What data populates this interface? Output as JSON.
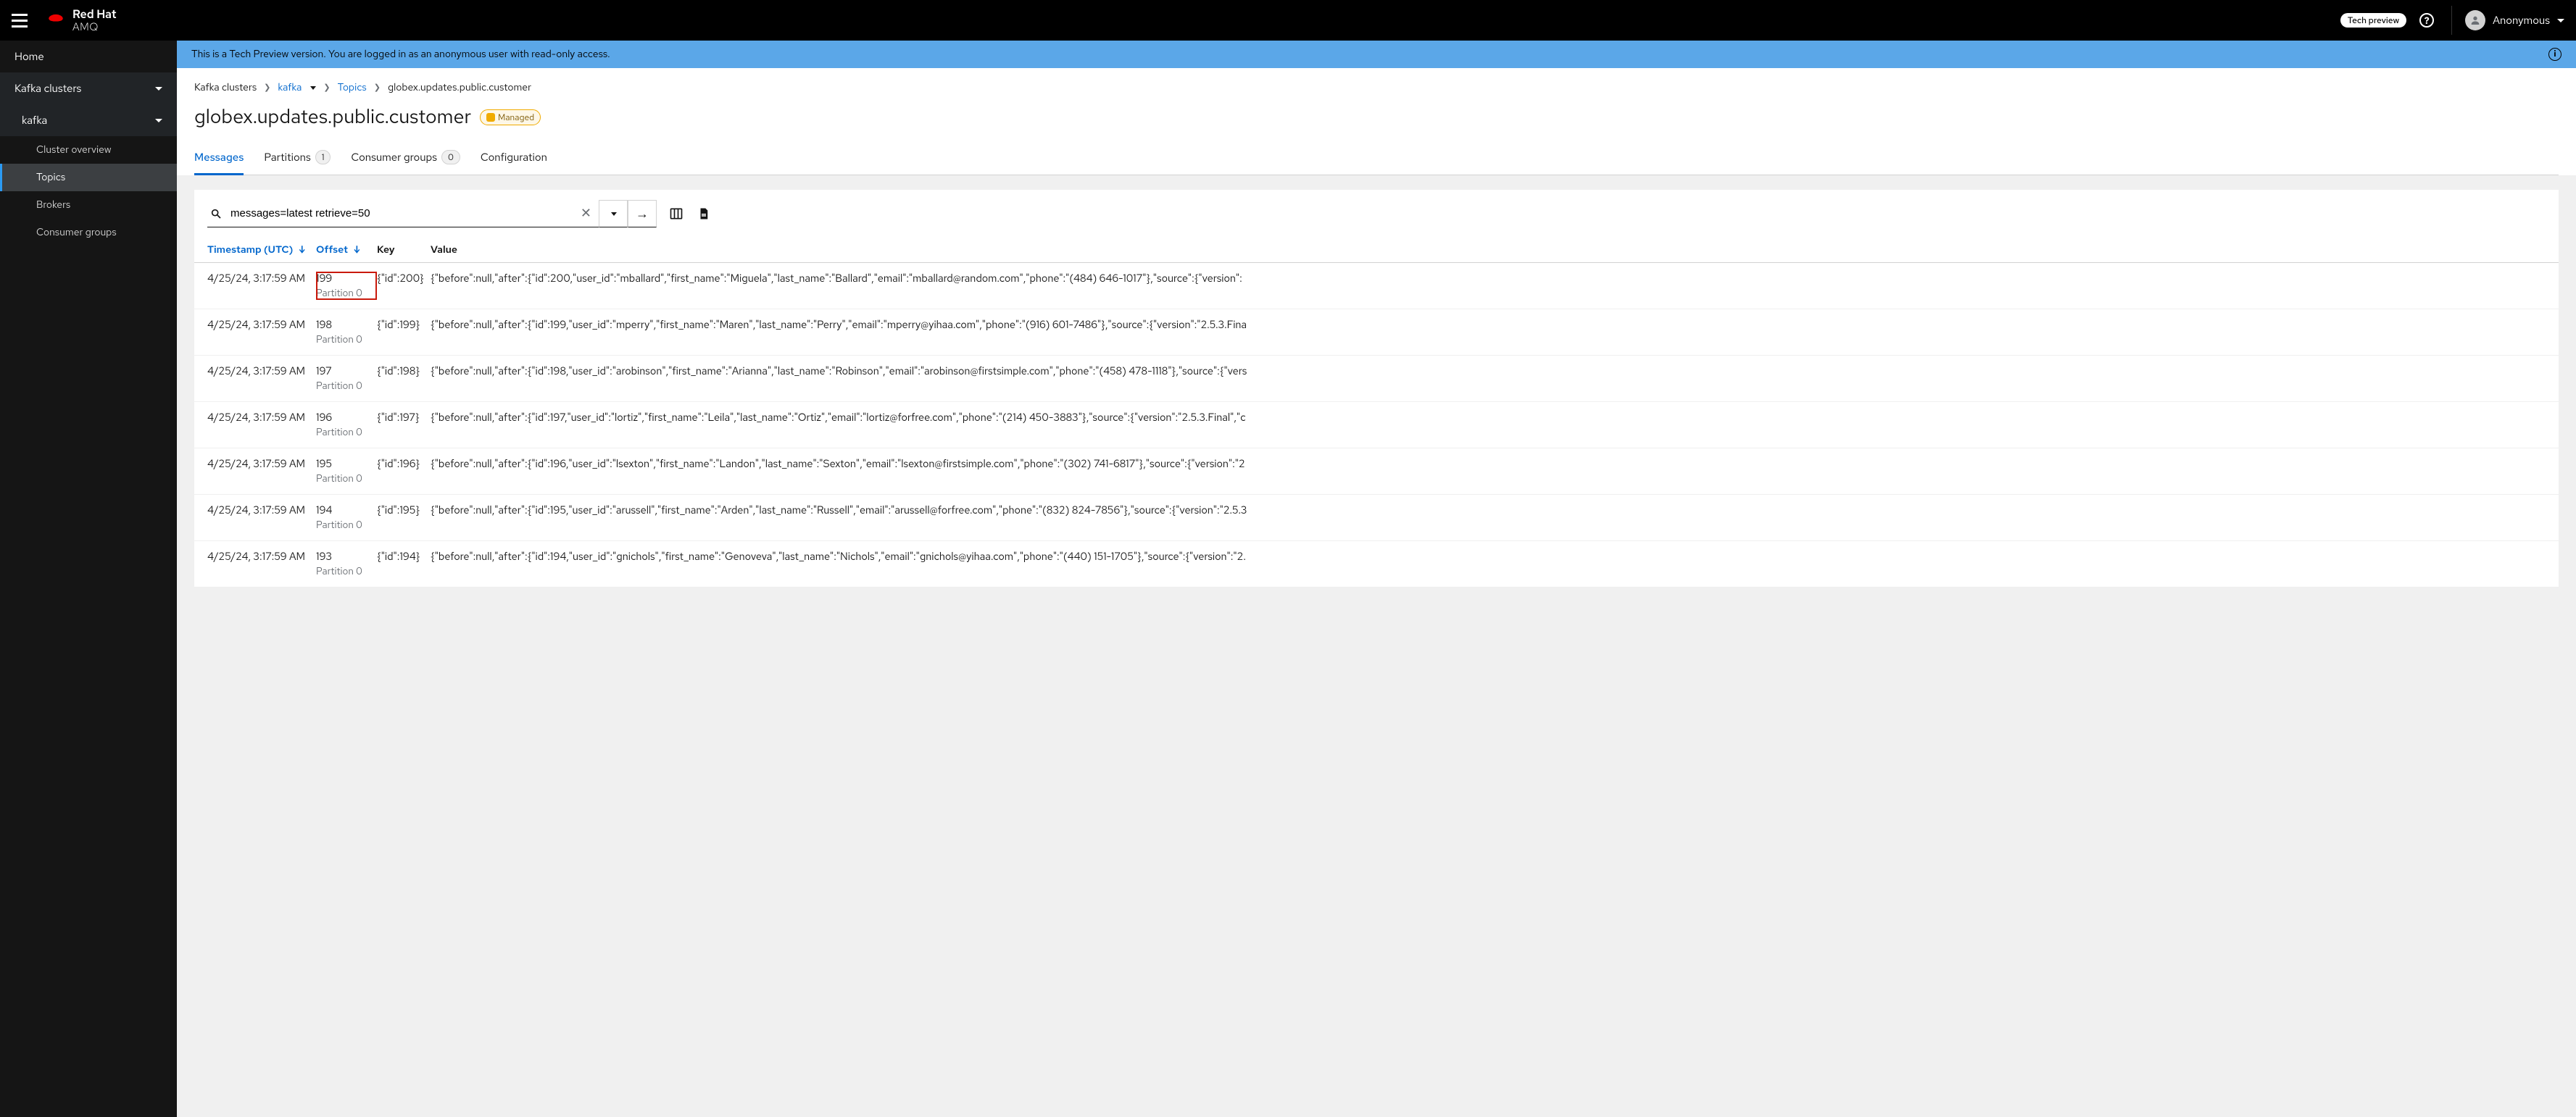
{
  "masthead": {
    "brand_title": "Red Hat",
    "brand_sub": "AMQ",
    "tech_preview_chip": "Tech preview",
    "user_name": "Anonymous"
  },
  "sidebar": {
    "home": "Home",
    "kafka_clusters": "Kafka clusters",
    "cluster_name": "kafka",
    "items": [
      {
        "label": "Cluster overview",
        "active": false
      },
      {
        "label": "Topics",
        "active": true
      },
      {
        "label": "Brokers",
        "active": false
      },
      {
        "label": "Consumer groups",
        "active": false
      }
    ]
  },
  "banner": {
    "text": "This is a Tech Preview version. You are logged in as an anonymous user with read-only access."
  },
  "breadcrumb": {
    "root": "Kafka clusters",
    "cluster": "kafka",
    "section": "Topics",
    "current": "globex.updates.public.customer"
  },
  "page": {
    "title": "globex.updates.public.customer",
    "badge": "Managed"
  },
  "tabs": [
    {
      "label": "Messages",
      "count": null,
      "active": true
    },
    {
      "label": "Partitions",
      "count": "1",
      "active": false
    },
    {
      "label": "Consumer groups",
      "count": "0",
      "active": false
    },
    {
      "label": "Configuration",
      "count": null,
      "active": false
    }
  ],
  "search": {
    "value": "messages=latest retrieve=50"
  },
  "columns": {
    "timestamp": "Timestamp (UTC)",
    "offset": "Offset",
    "key": "Key",
    "value": "Value"
  },
  "partition_label_prefix": "Partition ",
  "rows": [
    {
      "ts": "4/25/24, 3:17:59 AM",
      "offset": "199",
      "partition": "0",
      "key": "{\"id\":200}",
      "value": "{\"before\":null,\"after\":{\"id\":200,\"user_id\":\"mballard\",\"first_name\":\"Miguela\",\"last_name\":\"Ballard\",\"email\":\"mballard@random.com\",\"phone\":\"(484) 646-1017\"},\"source\":{\"version\":",
      "highlight": true
    },
    {
      "ts": "4/25/24, 3:17:59 AM",
      "offset": "198",
      "partition": "0",
      "key": "{\"id\":199}",
      "value": "{\"before\":null,\"after\":{\"id\":199,\"user_id\":\"mperry\",\"first_name\":\"Maren\",\"last_name\":\"Perry\",\"email\":\"mperry@yihaa.com\",\"phone\":\"(916) 601-7486\"},\"source\":{\"version\":\"2.5.3.Fina",
      "highlight": false
    },
    {
      "ts": "4/25/24, 3:17:59 AM",
      "offset": "197",
      "partition": "0",
      "key": "{\"id\":198}",
      "value": "{\"before\":null,\"after\":{\"id\":198,\"user_id\":\"arobinson\",\"first_name\":\"Arianna\",\"last_name\":\"Robinson\",\"email\":\"arobinson@firstsimple.com\",\"phone\":\"(458) 478-1118\"},\"source\":{\"vers",
      "highlight": false
    },
    {
      "ts": "4/25/24, 3:17:59 AM",
      "offset": "196",
      "partition": "0",
      "key": "{\"id\":197}",
      "value": "{\"before\":null,\"after\":{\"id\":197,\"user_id\":\"lortiz\",\"first_name\":\"Leila\",\"last_name\":\"Ortiz\",\"email\":\"lortiz@forfree.com\",\"phone\":\"(214) 450-3883\"},\"source\":{\"version\":\"2.5.3.Final\",\"c",
      "highlight": false
    },
    {
      "ts": "4/25/24, 3:17:59 AM",
      "offset": "195",
      "partition": "0",
      "key": "{\"id\":196}",
      "value": "{\"before\":null,\"after\":{\"id\":196,\"user_id\":\"lsexton\",\"first_name\":\"Landon\",\"last_name\":\"Sexton\",\"email\":\"lsexton@firstsimple.com\",\"phone\":\"(302) 741-6817\"},\"source\":{\"version\":\"2",
      "highlight": false
    },
    {
      "ts": "4/25/24, 3:17:59 AM",
      "offset": "194",
      "partition": "0",
      "key": "{\"id\":195}",
      "value": "{\"before\":null,\"after\":{\"id\":195,\"user_id\":\"arussell\",\"first_name\":\"Arden\",\"last_name\":\"Russell\",\"email\":\"arussell@forfree.com\",\"phone\":\"(832) 824-7856\"},\"source\":{\"version\":\"2.5.3",
      "highlight": false
    },
    {
      "ts": "4/25/24, 3:17:59 AM",
      "offset": "193",
      "partition": "0",
      "key": "{\"id\":194}",
      "value": "{\"before\":null,\"after\":{\"id\":194,\"user_id\":\"gnichols\",\"first_name\":\"Genoveva\",\"last_name\":\"Nichols\",\"email\":\"gnichols@yihaa.com\",\"phone\":\"(440) 151-1705\"},\"source\":{\"version\":\"2.",
      "highlight": false
    }
  ]
}
